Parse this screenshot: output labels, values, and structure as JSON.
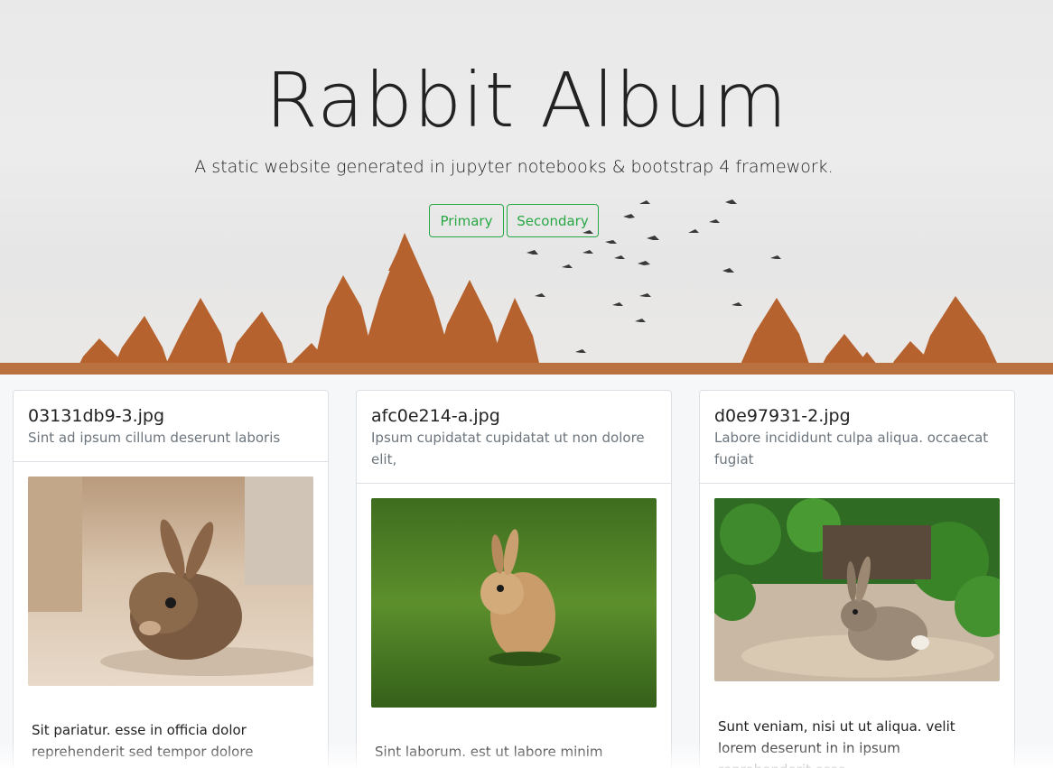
{
  "hero": {
    "title": "Rabbit Album",
    "subtitle": "A static website generated in jupyter notebooks & bootstrap 4 framework.",
    "primary_label": "Primary",
    "secondary_label": "Secondary"
  },
  "colors": {
    "accent": "#28a745",
    "tree": "#b5622f",
    "muted": "#6c757d"
  },
  "cards": [
    {
      "title": "03131db9-3.jpg",
      "subtitle": "Sint ad ipsum cillum deserunt laboris",
      "image": "rabbit-on-carpet",
      "text": "Sit pariatur. esse in officia dolor reprehenderit sed tempor dolore"
    },
    {
      "title": "afc0e214-a.jpg",
      "subtitle": "Ipsum cupidatat cupidatat ut non dolore elit,",
      "image": "rabbit-on-grass",
      "text": "Sint laborum. est ut labore minim magna"
    },
    {
      "title": "d0e97931-2.jpg",
      "subtitle": "Labore incididunt culpa aliqua. occaecat fugiat",
      "image": "rabbit-under-bushes",
      "text": "Sunt veniam, nisi ut ut aliqua. velit lorem deserunt in in ipsum reprehenderit esse"
    }
  ]
}
